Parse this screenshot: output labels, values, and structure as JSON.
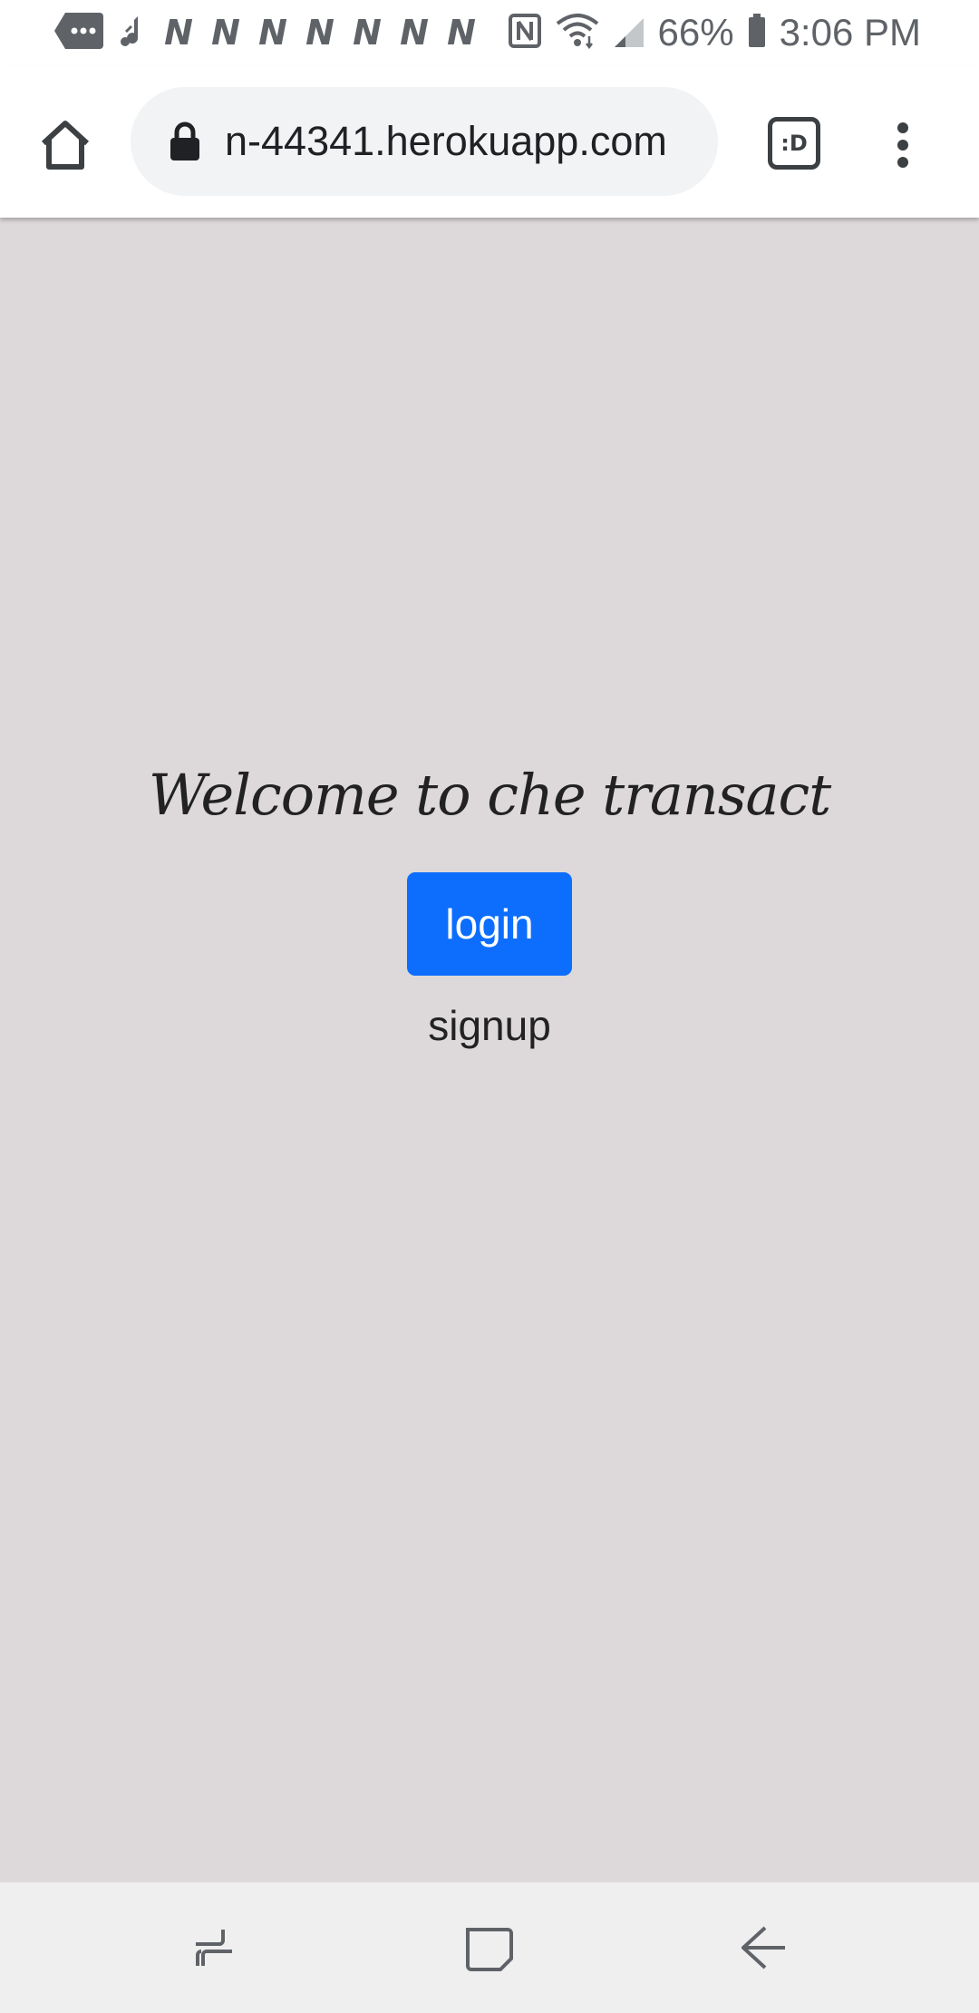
{
  "status_bar": {
    "notification_icons": [
      "message-icon",
      "music-icon"
    ],
    "n_icons": [
      "N",
      "N",
      "N",
      "N",
      "N",
      "N",
      "N"
    ],
    "right_icons": [
      "nfc-icon",
      "wifi-icon",
      "signal-icon"
    ],
    "battery_percent": "66%",
    "time": "3:06 PM"
  },
  "browser": {
    "url": "n-44341.herokuapp.com",
    "tabs_label": ":D"
  },
  "page": {
    "welcome_text": "Welcome to che transact",
    "login_label": "login",
    "signup_label": "signup"
  },
  "colors": {
    "page_background": "#ddd8d9",
    "login_button": "#0d6efd",
    "nav_background": "#efefef"
  },
  "nav_bar": {
    "buttons": [
      "recents-icon",
      "home-icon",
      "back-icon"
    ]
  }
}
